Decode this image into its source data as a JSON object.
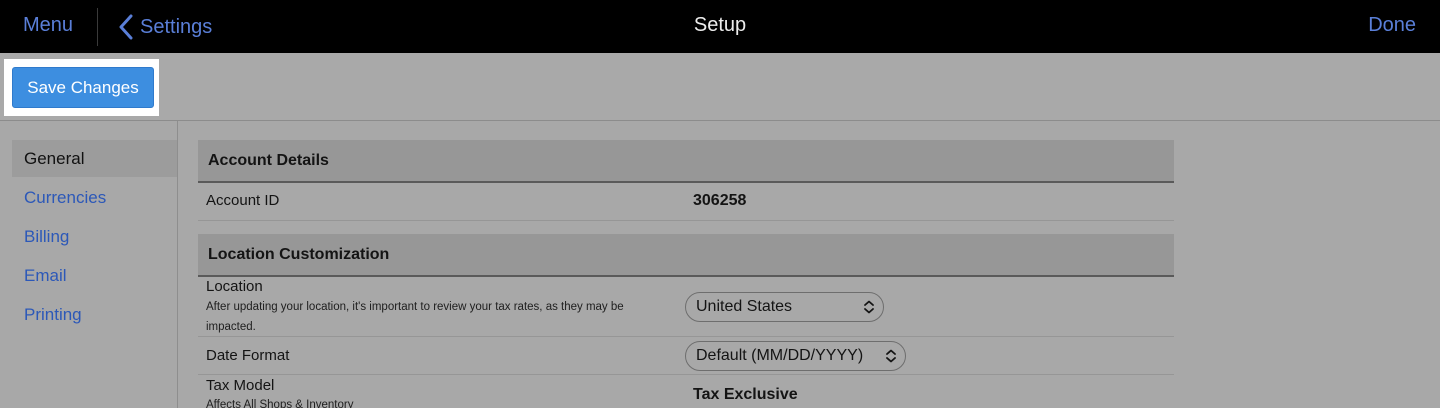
{
  "topbar": {
    "menu_label": "Menu",
    "back_label": "Settings",
    "title": "Setup",
    "done_label": "Done"
  },
  "toolbar": {
    "save_label": "Save Changes"
  },
  "sidebar": {
    "items": [
      {
        "label": "General",
        "active": true
      },
      {
        "label": "Currencies",
        "active": false
      },
      {
        "label": "Billing",
        "active": false
      },
      {
        "label": "Email",
        "active": false
      },
      {
        "label": "Printing",
        "active": false
      }
    ]
  },
  "account_details": {
    "header": "Account Details",
    "account_id_label": "Account ID",
    "account_id_value": "306258"
  },
  "location_customization": {
    "header": "Location Customization",
    "location_label": "Location",
    "location_desc": "After updating your location, it's important to review your tax rates, as they may be impacted.",
    "location_value": "United States",
    "date_format_label": "Date Format",
    "date_format_value": "Default (MM/DD/YYYY)",
    "tax_model_label": "Tax Model",
    "tax_model_desc": "Affects All Shops & Inventory",
    "tax_model_value": "Tax Exclusive"
  },
  "colors": {
    "accent_link": "#5a7fd8",
    "primary_button": "#3d8ee0",
    "sidebar_link": "#2c58b8"
  }
}
